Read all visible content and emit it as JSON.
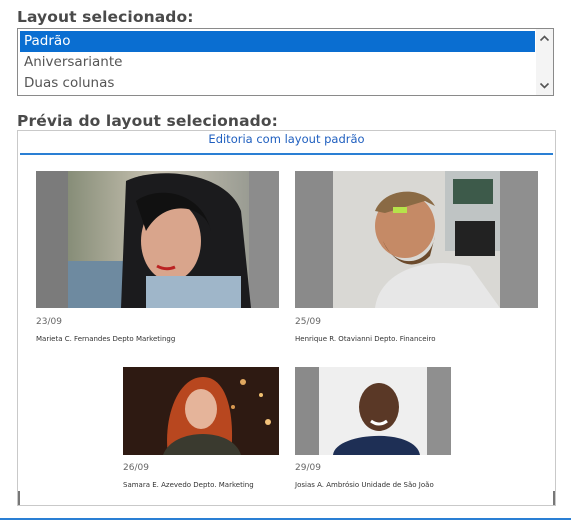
{
  "layout_label": "Layout selecionado:",
  "layout_options": [
    "Padrão",
    "Aniversariante",
    "Duas colunas"
  ],
  "selected_index": 0,
  "preview_label": "Prévia do layout selecionado:",
  "preview": {
    "title": "Editoria com layout padrão",
    "cards": [
      {
        "date": "23/09",
        "caption": "Marieta C. Fernandes Depto Marketingg"
      },
      {
        "date": "25/09",
        "caption": "Henrique R. Otavianni Depto. Financeiro"
      },
      {
        "date": "26/09",
        "caption": "Samara E. Azevedo Depto. Marketing"
      },
      {
        "date": "29/09",
        "caption": "Josias A. Ambrósio Unidade de São João"
      }
    ]
  },
  "colors": {
    "accent": "#0a6ed1",
    "title_blue": "#1f5fbf"
  },
  "icons": {
    "scroll_up": "chevron-up-icon",
    "scroll_down": "chevron-down-icon"
  }
}
